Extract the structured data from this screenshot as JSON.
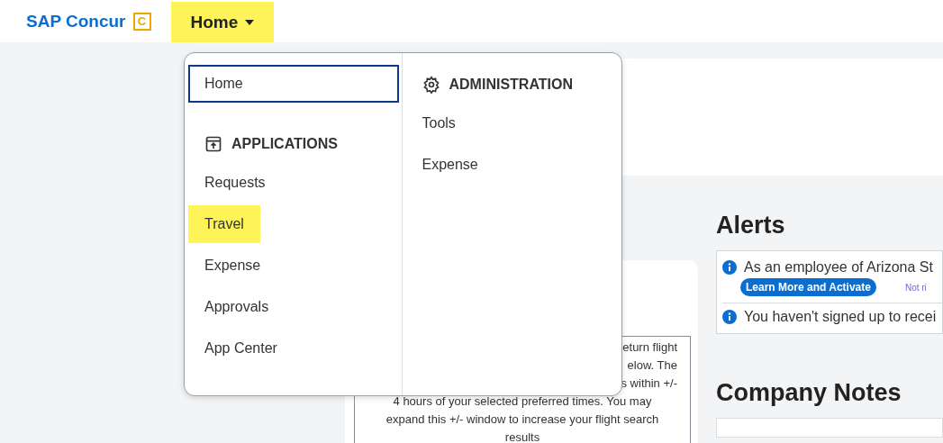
{
  "header": {
    "logo": {
      "text": "SAP Concur",
      "mark": "C"
    },
    "nav": [
      {
        "label": "Home",
        "highlighted": true,
        "expanded": true
      }
    ]
  },
  "menu": {
    "left": [
      {
        "kind": "item",
        "label": "Home",
        "focused": true,
        "highlighted": false
      },
      {
        "kind": "heading",
        "label": "APPLICATIONS"
      },
      {
        "kind": "item",
        "label": "Requests",
        "focused": false,
        "highlighted": false
      },
      {
        "kind": "item",
        "label": "Travel",
        "focused": false,
        "highlighted": true
      },
      {
        "kind": "item",
        "label": "Expense",
        "focused": false,
        "highlighted": false
      },
      {
        "kind": "item",
        "label": "Approvals",
        "focused": false,
        "highlighted": false
      },
      {
        "kind": "item",
        "label": "App Center",
        "focused": false,
        "highlighted": false
      }
    ],
    "right": [
      {
        "kind": "heading",
        "label": "ADMINISTRATION"
      },
      {
        "kind": "item",
        "label": "Tools",
        "focused": false,
        "highlighted": false
      },
      {
        "kind": "item",
        "label": "Expense",
        "focused": false,
        "highlighted": false
      }
    ]
  },
  "flight_note": {
    "lines": [
      {
        "text": "eturn flight",
        "partial": true
      },
      {
        "text": "elow. The",
        "partial": true
      },
      {
        "text": "s within +/-",
        "partial": true
      },
      {
        "text": "4 hours of your selected preferred times. You may",
        "partial": false
      },
      {
        "text": "expand this +/- window to increase your flight search",
        "partial": false
      },
      {
        "text": "results",
        "partial": false
      }
    ]
  },
  "alerts": {
    "title": "Alerts",
    "items": [
      {
        "text": "As an employee of Arizona St",
        "button": "Learn More and Activate",
        "link": "Not ri"
      },
      {
        "text": "You haven't signed up to recei"
      }
    ]
  },
  "company_notes": {
    "title": "Company Notes"
  }
}
